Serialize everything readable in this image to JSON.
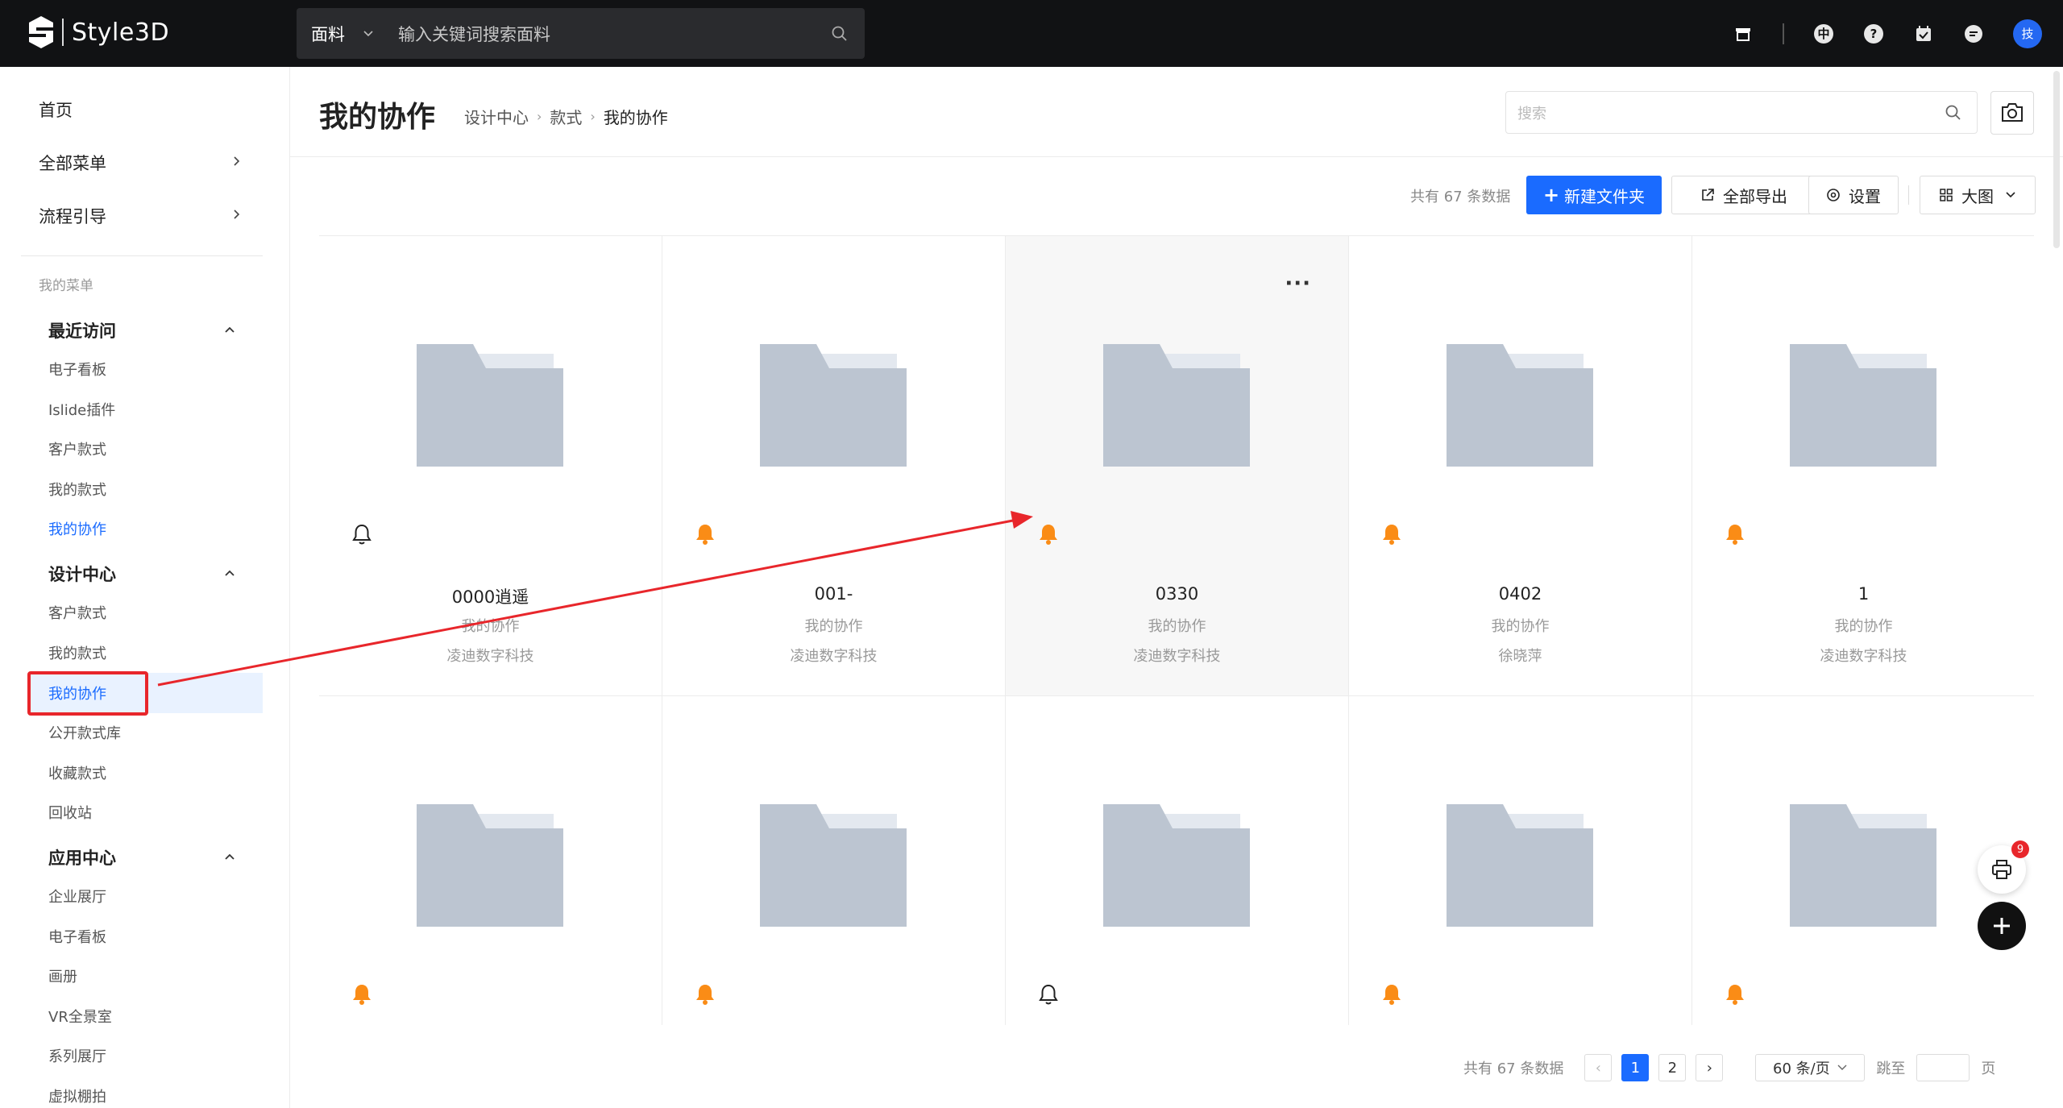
{
  "app": {
    "brand": "Style3D"
  },
  "top_search": {
    "category": "面料",
    "placeholder": "输入关键词搜索面料"
  },
  "user": {
    "avatar_text": "技"
  },
  "top_icons": [
    "store-icon",
    "globe-icon",
    "help-icon",
    "calendar-check-icon",
    "chat-icon"
  ],
  "sidebar": {
    "top_items": [
      {
        "label": "首页",
        "has_chevron": false
      },
      {
        "label": "全部菜单",
        "has_chevron": true
      },
      {
        "label": "流程引导",
        "has_chevron": true
      }
    ],
    "my_menu_label": "我的菜单",
    "groups": [
      {
        "title": "最近访问",
        "items": [
          "电子看板",
          "Islide插件",
          "客户款式",
          "我的款式",
          "我的协作"
        ],
        "active": "我的协作"
      },
      {
        "title": "设计中心",
        "items": [
          "客户款式",
          "我的款式",
          "我的协作",
          "公开款式库",
          "收藏款式",
          "回收站"
        ],
        "active": "我的协作"
      },
      {
        "title": "应用中心",
        "items": [
          "企业展厅",
          "电子看板",
          "画册",
          "VR全景室",
          "系列展厅",
          "虚拟棚拍"
        ],
        "active": ""
      }
    ]
  },
  "header": {
    "title": "我的协作",
    "breadcrumb": [
      "设计中心",
      "款式",
      "我的协作"
    ],
    "search_placeholder": "搜索"
  },
  "toolbar": {
    "total": "共有 67 条数据",
    "new_folder": "新建文件夹",
    "export_all": "全部导出",
    "settings": "设置",
    "view_mode": "大图"
  },
  "cards": [
    {
      "name": "0000逍遥",
      "sub1": "我的协作",
      "sub2": "凌迪数字科技",
      "bell": "outline"
    },
    {
      "name": "001-",
      "sub1": "我的协作",
      "sub2": "凌迪数字科技",
      "bell": "filled"
    },
    {
      "name": "0330",
      "sub1": "我的协作",
      "sub2": "凌迪数字科技",
      "bell": "filled",
      "hover": true
    },
    {
      "name": "0402",
      "sub1": "我的协作",
      "sub2": "徐晓萍",
      "bell": "filled"
    },
    {
      "name": "1",
      "sub1": "我的协作",
      "sub2": "凌迪数字科技",
      "bell": "filled"
    },
    {
      "name": "",
      "sub1": "",
      "sub2": "",
      "bell": "filled"
    },
    {
      "name": "",
      "sub1": "",
      "sub2": "",
      "bell": "filled"
    },
    {
      "name": "",
      "sub1": "",
      "sub2": "",
      "bell": "outline"
    },
    {
      "name": "",
      "sub1": "",
      "sub2": "",
      "bell": "filled"
    },
    {
      "name": "",
      "sub1": "",
      "sub2": "",
      "bell": "filled"
    }
  ],
  "more_label": "···",
  "pagination": {
    "total": "共有 67 条数据",
    "pages": [
      "1",
      "2"
    ],
    "current": "1",
    "page_size": "60 条/页",
    "jump_label": "跳至",
    "page_unit": "页"
  },
  "float": {
    "print_badge": "9"
  },
  "colors": {
    "primary": "#1a6bff",
    "topbar": "#111214",
    "bell": "#fa8c16",
    "annotation": "#e8262b",
    "folder": "#bcc5d1"
  }
}
